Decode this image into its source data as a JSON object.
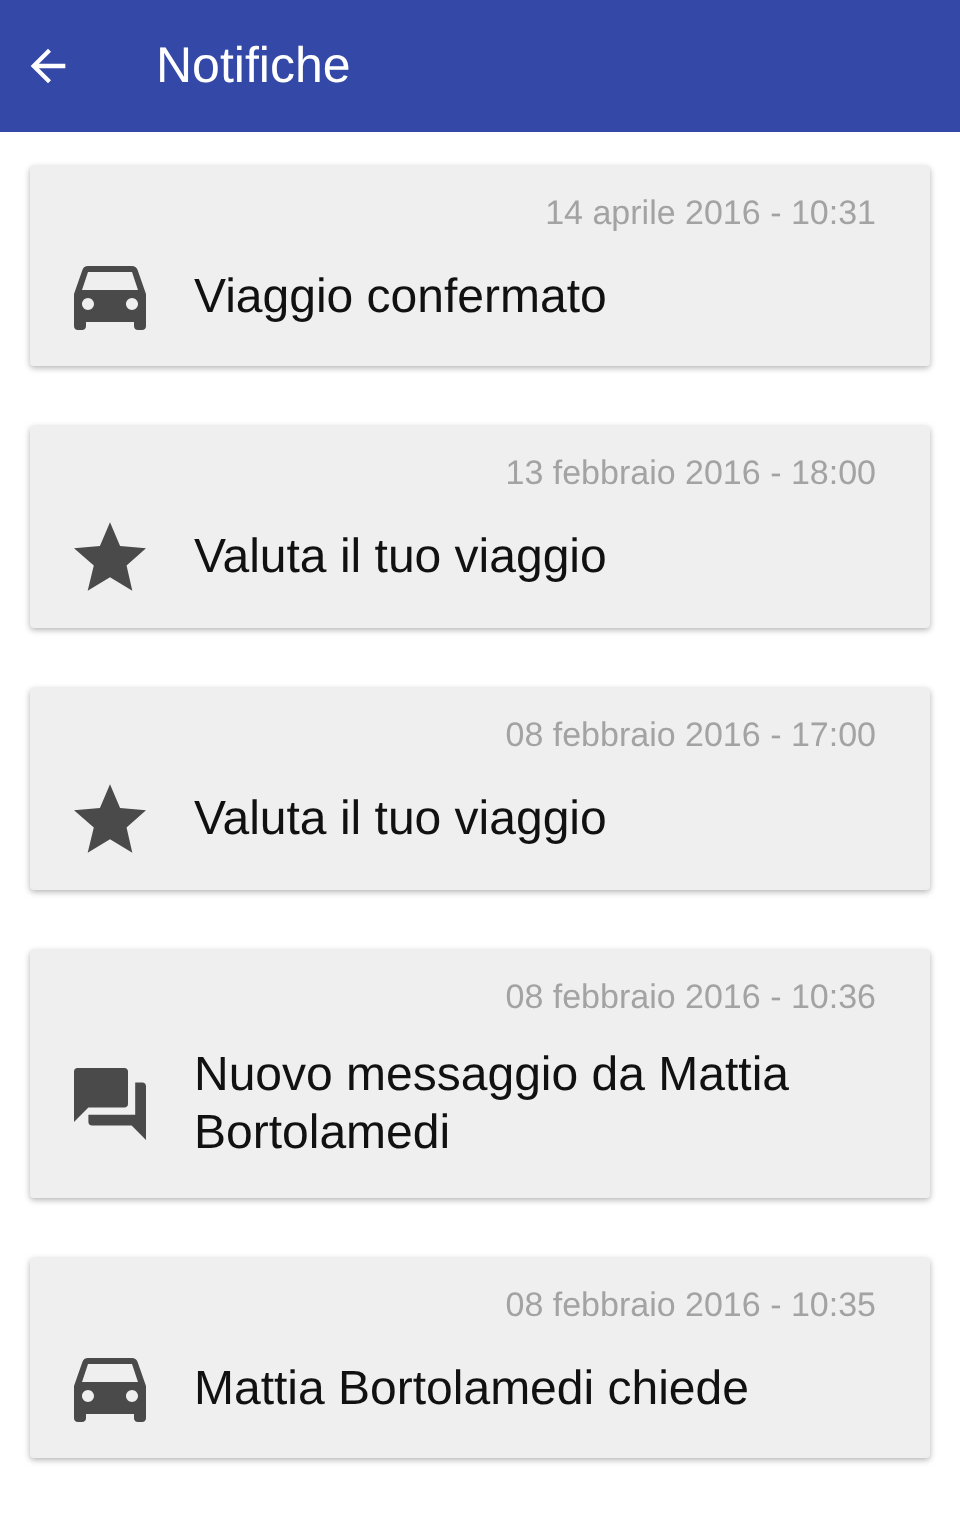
{
  "app_bar": {
    "title": "Notifiche"
  },
  "notifications": [
    {
      "kind": "car",
      "date": "14 aprile 2016 - 10:31",
      "title": "Viaggio confermato"
    },
    {
      "kind": "star",
      "date": "13 febbraio 2016 - 18:00",
      "title": "Valuta il tuo viaggio"
    },
    {
      "kind": "star",
      "date": "08 febbraio 2016 - 17:00",
      "title": "Valuta il tuo viaggio"
    },
    {
      "kind": "chat",
      "date": "08 febbraio 2016 - 10:36",
      "title": "Nuovo messaggio da Mattia Bortolamedi"
    },
    {
      "kind": "car",
      "date": "08 febbraio 2016 - 10:35",
      "title": "Mattia Bortolamedi chiede"
    }
  ]
}
